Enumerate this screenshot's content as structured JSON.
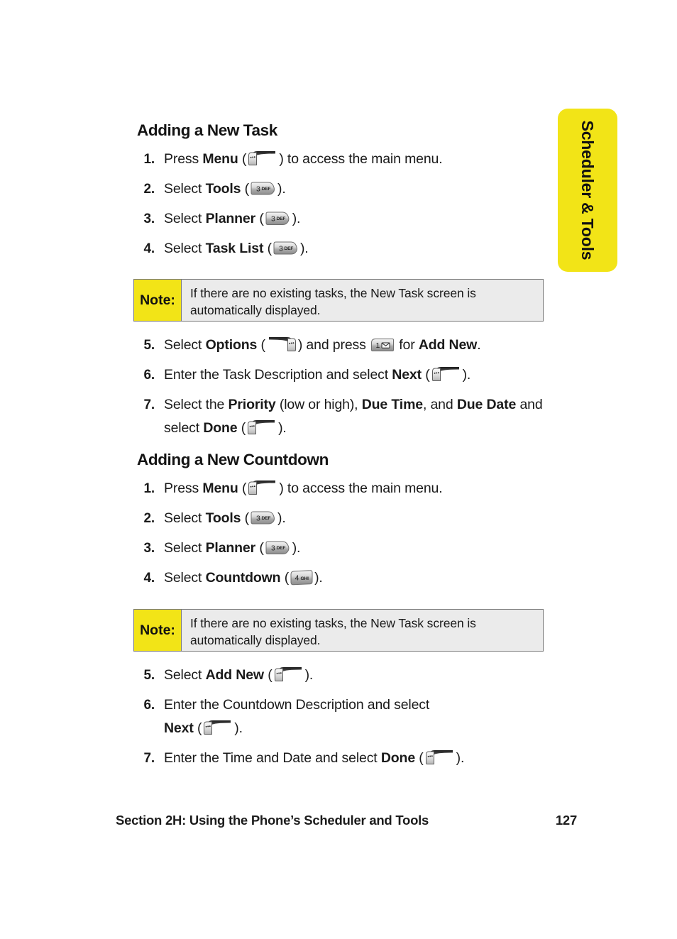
{
  "side_tab": {
    "label": "Scheduler & Tools",
    "color": "#f2e417"
  },
  "sections": [
    {
      "heading": "Adding a New Task",
      "steps_before_note": [
        {
          "num": "1.",
          "text_parts": [
            "Press ",
            "Menu",
            " (",
            "KEY_SOFT_LEFT",
            ") to access the main menu."
          ]
        },
        {
          "num": "2.",
          "text_parts": [
            "Select ",
            "Tools",
            " (",
            "KEY_3_DEF",
            ")."
          ]
        },
        {
          "num": "3.",
          "text_parts": [
            "Select ",
            "Planner",
            " (",
            "KEY_3_DEF",
            ")."
          ]
        },
        {
          "num": "4.",
          "text_parts": [
            "Select ",
            "Task List",
            " (",
            "KEY_3_DEF",
            ")."
          ]
        }
      ],
      "note": {
        "label": "Note:",
        "text": "If there are no existing tasks, the New Task screen is automatically displayed."
      },
      "steps_after_note": [
        {
          "num": "5.",
          "text_parts": [
            "Select ",
            "Options",
            " (",
            "KEY_SOFT_RIGHT",
            ") and press ",
            "KEY_1_MSG",
            " for ",
            "Add New",
            "."
          ]
        },
        {
          "num": "6.",
          "text_parts": [
            "Enter the Task Description and select ",
            "Next",
            " (",
            "KEY_SOFT_LEFT",
            ")."
          ]
        },
        {
          "num": "7.",
          "text_parts": [
            "Select the ",
            "Priority",
            " (low or high), ",
            "Due Time",
            ", and ",
            "Due Date",
            " and select ",
            "Done",
            " (",
            "KEY_SOFT_LEFT",
            ")."
          ]
        }
      ]
    },
    {
      "heading": "Adding a New Countdown",
      "steps_before_note": [
        {
          "num": "1.",
          "text_parts": [
            "Press ",
            "Menu",
            " (",
            "KEY_SOFT_LEFT",
            ") to access the main menu."
          ]
        },
        {
          "num": "2.",
          "text_parts": [
            "Select ",
            "Tools",
            " (",
            "KEY_3_DEF",
            ")."
          ]
        },
        {
          "num": "3.",
          "text_parts": [
            "Select ",
            "Planner",
            " (",
            "KEY_3_DEF",
            ")."
          ]
        },
        {
          "num": "4.",
          "text_parts": [
            "Select ",
            "Countdown",
            " (",
            "KEY_4_GHI",
            ")."
          ]
        }
      ],
      "note": {
        "label": "Note:",
        "text": "If there are no existing tasks, the New Task screen is automatically displayed."
      },
      "steps_after_note": [
        {
          "num": "5.",
          "text_parts": [
            "Select ",
            "Add New",
            " (",
            "KEY_SOFT_LEFT",
            ")."
          ]
        },
        {
          "num": "6.",
          "text_parts": [
            "Enter the Countdown Description and select ",
            "Next",
            " (",
            "KEY_SOFT_LEFT",
            ")."
          ]
        },
        {
          "num": "7.",
          "text_parts": [
            "Enter the Time and Date and select ",
            "Done",
            " (",
            "KEY_SOFT_LEFT",
            ")."
          ]
        }
      ]
    }
  ],
  "steps": {
    "s1_1_a": "Press ",
    "s1_1_b": "Menu",
    "s1_1_c": " (",
    "s1_1_d": ") to access the main menu.",
    "s1_2_a": "Select ",
    "s1_2_b": "Tools",
    "s1_2_c": " (",
    "s1_2_d": ").",
    "s1_3_a": "Select ",
    "s1_3_b": "Planner",
    "s1_3_c": " (",
    "s1_3_d": ").",
    "s1_4_a": "Select ",
    "s1_4_b": "Task List",
    "s1_4_c": " (",
    "s1_4_d": ").",
    "s1_5_a": "Select ",
    "s1_5_b": "Options",
    "s1_5_c": " (",
    "s1_5_d": ") and press ",
    "s1_5_e": " for ",
    "s1_5_f": "Add New",
    "s1_5_g": ".",
    "s1_6_a": "Enter the Task Description and select ",
    "s1_6_b": "Next",
    "s1_6_c": " (",
    "s1_6_d": ").",
    "s1_7_a": "Select the ",
    "s1_7_b": "Priority",
    "s1_7_c": " (low or high), ",
    "s1_7_d": "Due Time",
    "s1_7_e": ", and ",
    "s1_7_f": "Due Date",
    "s1_7_g": " and select ",
    "s1_7_h": "Done",
    "s1_7_i": " (",
    "s1_7_j": ").",
    "s2_1_a": "Press ",
    "s2_1_b": "Menu",
    "s2_1_c": " (",
    "s2_1_d": ") to access the main menu.",
    "s2_2_a": "Select ",
    "s2_2_b": "Tools",
    "s2_2_c": " (",
    "s2_2_d": ").",
    "s2_3_a": "Select ",
    "s2_3_b": "Planner",
    "s2_3_c": " (",
    "s2_3_d": ").",
    "s2_4_a": "Select ",
    "s2_4_b": "Countdown",
    "s2_4_c": " (",
    "s2_4_d": ").",
    "s2_5_a": "Select ",
    "s2_5_b": "Add New",
    "s2_5_c": " (",
    "s2_5_d": ").",
    "s2_6_a": "Enter the Countdown Description and select ",
    "s2_6_b": "Next",
    "s2_6_c": " (",
    "s2_6_d": ").",
    "s2_7_a": "Enter the Time and Date and select ",
    "s2_7_b": "Done",
    "s2_7_c": " (",
    "s2_7_d": ")."
  },
  "numbers": {
    "n1": "1.",
    "n2": "2.",
    "n3": "3.",
    "n4": "4.",
    "n5": "5.",
    "n6": "6.",
    "n7": "7."
  },
  "keys": {
    "soft_left": "left-softkey",
    "soft_right": "right-softkey",
    "three": "3",
    "three_letters": "DEF",
    "four": "4",
    "four_letters": "GHI",
    "one": "1",
    "one_glyph": "envelope"
  },
  "footer": {
    "section": "Section 2H: Using the Phone’s Scheduler and Tools",
    "page_number": "127"
  }
}
